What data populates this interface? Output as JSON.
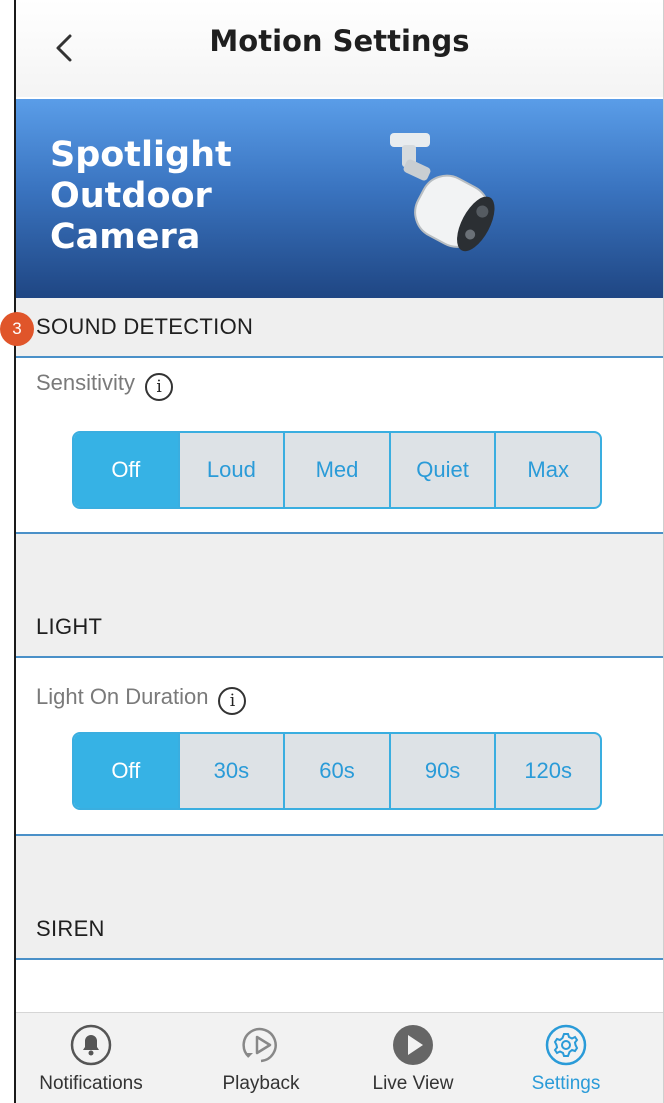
{
  "header": {
    "title": "Motion Settings",
    "back_icon": "chevron-left-icon"
  },
  "banner": {
    "line1": "Spotlight",
    "line2": "Outdoor",
    "line3": "Camera",
    "image": "spotlight-camera-image"
  },
  "sound_detection": {
    "badge": "3",
    "title": "SOUND DETECTION",
    "sensitivity_label": "Sensitivity",
    "options": [
      "Off",
      "Loud",
      "Med",
      "Quiet",
      "Max"
    ],
    "selected": "Off"
  },
  "light": {
    "title": "LIGHT",
    "duration_label": "Light On Duration",
    "options": [
      "Off",
      "30s",
      "60s",
      "90s",
      "120s"
    ],
    "selected": "Off"
  },
  "siren": {
    "title": "SIREN"
  },
  "info_glyph": "i",
  "tabs": [
    {
      "label": "Notifications",
      "icon": "bell-icon"
    },
    {
      "label": "Playback",
      "icon": "playback-icon"
    },
    {
      "label": "Live View",
      "icon": "play-icon"
    },
    {
      "label": "Settings",
      "icon": "gear-icon",
      "active": true
    }
  ],
  "colors": {
    "accent": "#36b2e5",
    "banner": "#3a74c0",
    "badge": "#e0552a"
  }
}
